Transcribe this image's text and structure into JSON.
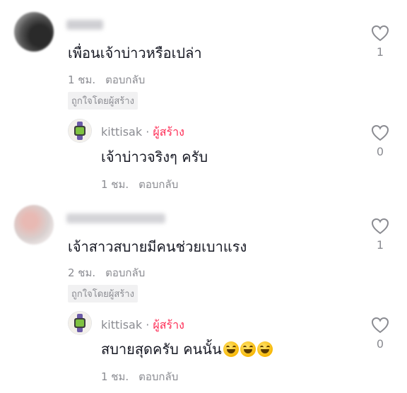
{
  "comments": [
    {
      "text": "เพื่อนเจ้าบ่าวหรือเปล่า",
      "time": "1 ชม.",
      "reply_label": "ตอบกลับ",
      "liked_by_creator": "ถูกใจโดยผู้สร้าง",
      "likes": "1",
      "reply": {
        "username": "kittisak",
        "separator": "·",
        "creator_badge": "ผู้สร้าง",
        "text": "เจ้าบ่าวจริงๆ ครับ",
        "time": "1 ชม.",
        "reply_label": "ตอบกลับ",
        "likes": "0"
      }
    },
    {
      "text": "เจ้าสาวสบายมีคนช่วยเบาแรง",
      "time": "2 ชม.",
      "reply_label": "ตอบกลับ",
      "liked_by_creator": "ถูกใจโดยผู้สร้าง",
      "likes": "1",
      "reply": {
        "username": "kittisak",
        "separator": "·",
        "creator_badge": "ผู้สร้าง",
        "text": "สบายสุดครับ คนนั้น",
        "emoji": "grinning-sweat-emoji x3",
        "time": "1 ชม.",
        "reply_label": "ตอบกลับ",
        "likes": "0"
      }
    }
  ],
  "colors": {
    "text": "#161823",
    "secondary": "#8a8b91",
    "creator_badge": "#fe2c55",
    "tag_bg": "#f1f1f2"
  }
}
